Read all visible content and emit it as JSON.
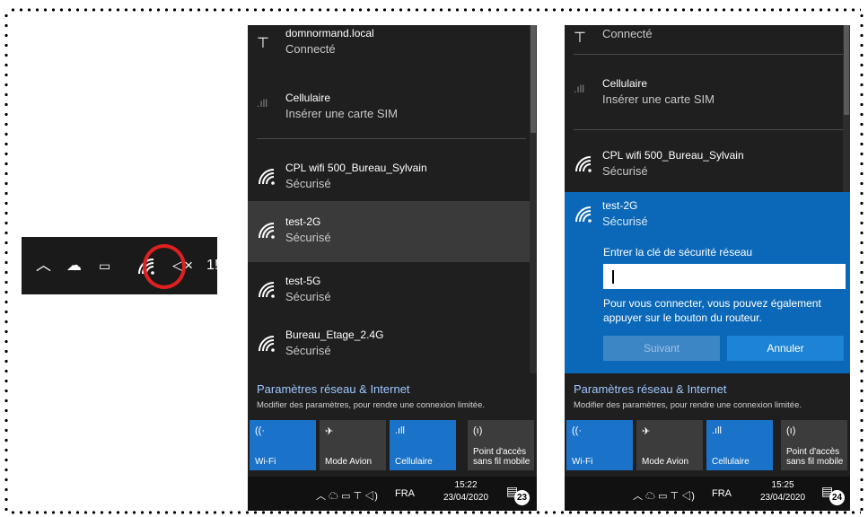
{
  "tray_small": {
    "clock_partial": "1!"
  },
  "panel1": {
    "networks": [
      {
        "name": "domnormand.local",
        "status": "Connecté"
      },
      {
        "name": "Cellulaire",
        "status": "Insérer une carte SIM"
      },
      {
        "name": "CPL wifi 500_Bureau_Sylvain",
        "status": "Sécurisé"
      },
      {
        "name": "test-2G",
        "status": "Sécurisé"
      },
      {
        "name": "test-5G",
        "status": "Sécurisé"
      },
      {
        "name": "Bureau_Etage_2.4G",
        "status": "Sécurisé"
      }
    ],
    "settings_title": "Paramètres réseau & Internet",
    "settings_sub": "Modifier des paramètres, pour rendre une connexion limitée.",
    "tiles": [
      "Wi-Fi",
      "Mode Avion",
      "Cellulaire",
      "Point d'accès\nsans fil mobile"
    ],
    "tile_line1": "Point d'accès",
    "tile_line2": "sans fil mobile",
    "lang": "FRA",
    "time": "15:22",
    "date": "23/04/2020",
    "notif_count": "23"
  },
  "panel2": {
    "networks": [
      {
        "name": "",
        "status": "Connecté"
      },
      {
        "name": "Cellulaire",
        "status": "Insérer une carte SIM"
      },
      {
        "name": "CPL wifi 500_Bureau_Sylvain",
        "status": "Sécurisé"
      },
      {
        "name": "test-2G",
        "status": "Sécurisé"
      }
    ],
    "key_label": "Entrer la clé de sécurité réseau",
    "key_value": "",
    "hint": "Pour vous connecter, vous pouvez également appuyer sur le bouton du routeur.",
    "next_label": "Suivant",
    "cancel_label": "Annuler",
    "settings_title": "Paramètres réseau & Internet",
    "settings_sub": "Modifier des paramètres, pour rendre une connexion limitée.",
    "tiles": [
      "Wi-Fi",
      "Mode Avion",
      "Cellulaire"
    ],
    "tile_line1": "Point d'accès",
    "tile_line2": "sans fil mobile",
    "lang": "FRA",
    "time": "15:25",
    "date": "23/04/2020",
    "notif_count": "24"
  },
  "colors": {
    "accent_blue": "#0b68b8",
    "tile_on": "#1a73c8",
    "highlight_ring": "#e02020"
  }
}
